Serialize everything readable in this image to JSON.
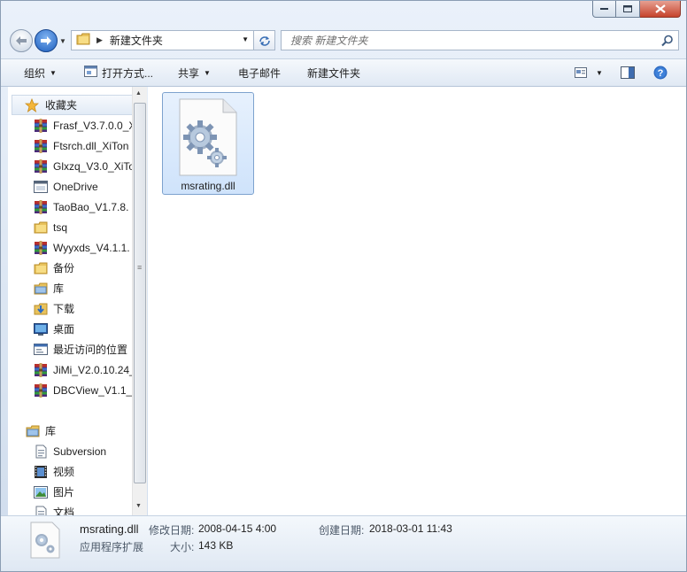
{
  "address": {
    "path": "新建文件夹"
  },
  "search": {
    "placeholder": "搜索 新建文件夹"
  },
  "toolbar": {
    "organize": "组织",
    "open_with": "打开方式...",
    "share": "共享",
    "email": "电子邮件",
    "new_folder": "新建文件夹"
  },
  "sidebar": {
    "favorites_label": "收藏夹",
    "favorites": [
      {
        "label": "Frasf_V3.7.0.0_X",
        "icon": "winrar-archive-icon"
      },
      {
        "label": "Ftsrch.dll_XiTon",
        "icon": "winrar-archive-icon"
      },
      {
        "label": "Glxzq_V3.0_XiTo",
        "icon": "winrar-archive-icon"
      },
      {
        "label": "OneDrive",
        "icon": "window-icon"
      },
      {
        "label": "TaoBao_V1.7.8.",
        "icon": "winrar-archive-icon"
      },
      {
        "label": "tsq",
        "icon": "folder-icon"
      },
      {
        "label": "Wyyxds_V4.1.1.",
        "icon": "winrar-archive-icon"
      },
      {
        "label": "备份",
        "icon": "folder-icon"
      },
      {
        "label": "库",
        "icon": "library-icon"
      },
      {
        "label": "下载",
        "icon": "downloads-icon"
      },
      {
        "label": "桌面",
        "icon": "desktop-icon"
      },
      {
        "label": "最近访问的位置",
        "icon": "recent-places-icon"
      },
      {
        "label": "JiMi_V2.0.10.24_",
        "icon": "winrar-archive-icon"
      },
      {
        "label": "DBCView_V1.1_",
        "icon": "winrar-archive-icon"
      }
    ],
    "libraries_label": "库",
    "libraries": [
      {
        "label": "Subversion",
        "icon": "document-library-icon"
      },
      {
        "label": "视频",
        "icon": "video-library-icon"
      },
      {
        "label": "图片",
        "icon": "picture-library-icon"
      },
      {
        "label": "文档",
        "icon": "document-library-icon"
      }
    ]
  },
  "files": [
    {
      "name": "msrating.dll",
      "icon": "dll-settings-file-icon"
    }
  ],
  "details": {
    "filename": "msrating.dll",
    "filetype": "应用程序扩展",
    "modified_label": "修改日期:",
    "modified_value": "2008-04-15 4:00",
    "created_label": "创建日期:",
    "created_value": "2018-03-01 11:43",
    "size_label": "大小:",
    "size_value": "143 KB"
  },
  "colors": {
    "accent": "#1d5fbf",
    "selection": "#cfe3fb"
  }
}
